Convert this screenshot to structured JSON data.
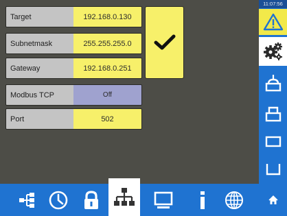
{
  "clock": "11:07:56",
  "fields": [
    {
      "label": "Target",
      "value": "192.168.0.130"
    },
    {
      "label": "Subnetmask",
      "value": "255.255.255.0"
    },
    {
      "label": "Gateway",
      "value": "192.168.0.251"
    },
    {
      "label": "Modbus TCP",
      "value": "Off"
    },
    {
      "label": "Port",
      "value": "502"
    }
  ],
  "icons": {
    "confirm": "checkmark-icon",
    "alarm": "warning-triangle-icon",
    "settings": "gears-icon",
    "sidebar": [
      "bell-outline-icon",
      "bell-closed-icon",
      "rectangle-icon",
      "open-box-icon"
    ],
    "bottom": [
      "network-tree-icon",
      "clock-icon",
      "lock-icon",
      "network-icon",
      "monitor-icon",
      "info-icon",
      "globe-icon"
    ],
    "corner": "home-icon"
  },
  "colors": {
    "value_yellow": "#f7f06a",
    "off_lavender": "#9fa2cf",
    "label_gray": "#c4c4c4",
    "bar_blue": "#1f73d1",
    "background": "#4d4d47"
  }
}
